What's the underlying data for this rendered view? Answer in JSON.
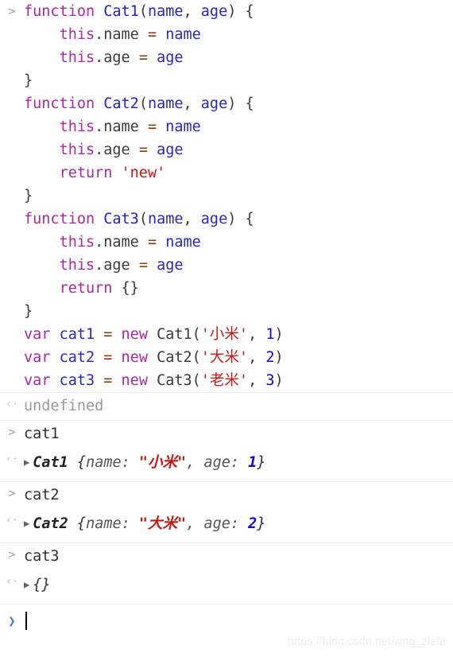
{
  "console": {
    "input_block": {
      "prompt_glyph": ">",
      "lines": [
        [
          {
            "t": "function ",
            "c": "kw"
          },
          {
            "t": "Cat1",
            "c": "fn-name"
          },
          {
            "t": "(",
            "c": "plain"
          },
          {
            "t": "name",
            "c": "ident"
          },
          {
            "t": ", ",
            "c": "plain"
          },
          {
            "t": "age",
            "c": "ident"
          },
          {
            "t": ") {",
            "c": "plain"
          }
        ],
        [
          {
            "t": "    ",
            "c": "plain"
          },
          {
            "t": "this",
            "c": "kw"
          },
          {
            "t": ".name ",
            "c": "plain"
          },
          {
            "t": "=",
            "c": "op"
          },
          {
            "t": " ",
            "c": "plain"
          },
          {
            "t": "name",
            "c": "ident"
          }
        ],
        [
          {
            "t": "    ",
            "c": "plain"
          },
          {
            "t": "this",
            "c": "kw"
          },
          {
            "t": ".age ",
            "c": "plain"
          },
          {
            "t": "=",
            "c": "op"
          },
          {
            "t": " ",
            "c": "plain"
          },
          {
            "t": "age",
            "c": "ident"
          }
        ],
        [
          {
            "t": "}",
            "c": "plain"
          }
        ],
        [
          {
            "t": "function ",
            "c": "kw"
          },
          {
            "t": "Cat2",
            "c": "fn-name"
          },
          {
            "t": "(",
            "c": "plain"
          },
          {
            "t": "name",
            "c": "ident"
          },
          {
            "t": ", ",
            "c": "plain"
          },
          {
            "t": "age",
            "c": "ident"
          },
          {
            "t": ") {",
            "c": "plain"
          }
        ],
        [
          {
            "t": "    ",
            "c": "plain"
          },
          {
            "t": "this",
            "c": "kw"
          },
          {
            "t": ".name ",
            "c": "plain"
          },
          {
            "t": "=",
            "c": "op"
          },
          {
            "t": " ",
            "c": "plain"
          },
          {
            "t": "name",
            "c": "ident"
          }
        ],
        [
          {
            "t": "    ",
            "c": "plain"
          },
          {
            "t": "this",
            "c": "kw"
          },
          {
            "t": ".age ",
            "c": "plain"
          },
          {
            "t": "=",
            "c": "op"
          },
          {
            "t": " ",
            "c": "plain"
          },
          {
            "t": "age",
            "c": "ident"
          }
        ],
        [
          {
            "t": "    ",
            "c": "plain"
          },
          {
            "t": "return",
            "c": "kw"
          },
          {
            "t": " ",
            "c": "plain"
          },
          {
            "t": "'new'",
            "c": "str"
          }
        ],
        [
          {
            "t": "}",
            "c": "plain"
          }
        ],
        [
          {
            "t": "function ",
            "c": "kw"
          },
          {
            "t": "Cat3",
            "c": "fn-name"
          },
          {
            "t": "(",
            "c": "plain"
          },
          {
            "t": "name",
            "c": "ident"
          },
          {
            "t": ", ",
            "c": "plain"
          },
          {
            "t": "age",
            "c": "ident"
          },
          {
            "t": ") {",
            "c": "plain"
          }
        ],
        [
          {
            "t": "    ",
            "c": "plain"
          },
          {
            "t": "this",
            "c": "kw"
          },
          {
            "t": ".name ",
            "c": "plain"
          },
          {
            "t": "=",
            "c": "op"
          },
          {
            "t": " ",
            "c": "plain"
          },
          {
            "t": "name",
            "c": "ident"
          }
        ],
        [
          {
            "t": "    ",
            "c": "plain"
          },
          {
            "t": "this",
            "c": "kw"
          },
          {
            "t": ".age ",
            "c": "plain"
          },
          {
            "t": "=",
            "c": "op"
          },
          {
            "t": " ",
            "c": "plain"
          },
          {
            "t": "age",
            "c": "ident"
          }
        ],
        [
          {
            "t": "    ",
            "c": "plain"
          },
          {
            "t": "return",
            "c": "kw"
          },
          {
            "t": " {}",
            "c": "plain"
          }
        ],
        [
          {
            "t": "}",
            "c": "plain"
          }
        ],
        [
          {
            "t": "var",
            "c": "kw"
          },
          {
            "t": " ",
            "c": "plain"
          },
          {
            "t": "cat1",
            "c": "ident"
          },
          {
            "t": " ",
            "c": "plain"
          },
          {
            "t": "=",
            "c": "op"
          },
          {
            "t": " ",
            "c": "plain"
          },
          {
            "t": "new",
            "c": "kw"
          },
          {
            "t": " Cat1(",
            "c": "plain"
          },
          {
            "t": "'小米'",
            "c": "str"
          },
          {
            "t": ", ",
            "c": "plain"
          },
          {
            "t": "1",
            "c": "num"
          },
          {
            "t": ")",
            "c": "plain"
          }
        ],
        [
          {
            "t": "var",
            "c": "kw"
          },
          {
            "t": " ",
            "c": "plain"
          },
          {
            "t": "cat2",
            "c": "ident"
          },
          {
            "t": " ",
            "c": "plain"
          },
          {
            "t": "=",
            "c": "op"
          },
          {
            "t": " ",
            "c": "plain"
          },
          {
            "t": "new",
            "c": "kw"
          },
          {
            "t": " Cat2(",
            "c": "plain"
          },
          {
            "t": "'大米'",
            "c": "str"
          },
          {
            "t": ", ",
            "c": "plain"
          },
          {
            "t": "2",
            "c": "num"
          },
          {
            "t": ")",
            "c": "plain"
          }
        ],
        [
          {
            "t": "var",
            "c": "kw"
          },
          {
            "t": " ",
            "c": "plain"
          },
          {
            "t": "cat3",
            "c": "ident"
          },
          {
            "t": " ",
            "c": "plain"
          },
          {
            "t": "=",
            "c": "op"
          },
          {
            "t": " ",
            "c": "plain"
          },
          {
            "t": "new",
            "c": "kw"
          },
          {
            "t": " Cat3(",
            "c": "plain"
          },
          {
            "t": "'老米'",
            "c": "str"
          },
          {
            "t": ", ",
            "c": "plain"
          },
          {
            "t": "3",
            "c": "num"
          },
          {
            "t": ")",
            "c": "plain"
          }
        ]
      ]
    },
    "undefined_result": {
      "arrow_glyph": "‹·",
      "text": "undefined"
    },
    "entries": [
      {
        "prompt_glyph": ">",
        "input": "cat1",
        "arrow_glyph": "‹·",
        "disclosure_glyph": "▶",
        "constructor": "Cat1",
        "open_brace": "{",
        "prop1_key": "name: ",
        "prop1_value": "\"小米\"",
        "separator": ", ",
        "prop2_key": "age: ",
        "prop2_value": "1",
        "close_brace": "}",
        "empty": false
      },
      {
        "prompt_glyph": ">",
        "input": "cat2",
        "arrow_glyph": "‹·",
        "disclosure_glyph": "▶",
        "constructor": "Cat2",
        "open_brace": "{",
        "prop1_key": "name: ",
        "prop1_value": "\"大米\"",
        "separator": ", ",
        "prop2_key": "age: ",
        "prop2_value": "2",
        "close_brace": "}",
        "empty": false
      },
      {
        "prompt_glyph": ">",
        "input": "cat3",
        "arrow_glyph": "‹·",
        "disclosure_glyph": "▶",
        "constructor": "",
        "open_brace": "{}",
        "prop1_key": "",
        "prop1_value": "",
        "separator": "",
        "prop2_key": "",
        "prop2_value": "",
        "close_brace": "",
        "empty": true
      }
    ],
    "active_prompt": {
      "glyph": "❯",
      "value": ""
    },
    "watermark": "https://blog.csdn.net/xing_zlear"
  },
  "colors": {
    "keyword": "#aa27a5",
    "function_name": "#2222cc",
    "identifier": "#2727c9",
    "string": "#c41a16",
    "number": "#1c00cf",
    "operator": "#8b3a10",
    "plain": "#3b3b3b",
    "muted": "#9b9b9b",
    "divider": "#ebebeb",
    "prompt_blue": "#4a78d8",
    "watermark": "#ececec"
  }
}
